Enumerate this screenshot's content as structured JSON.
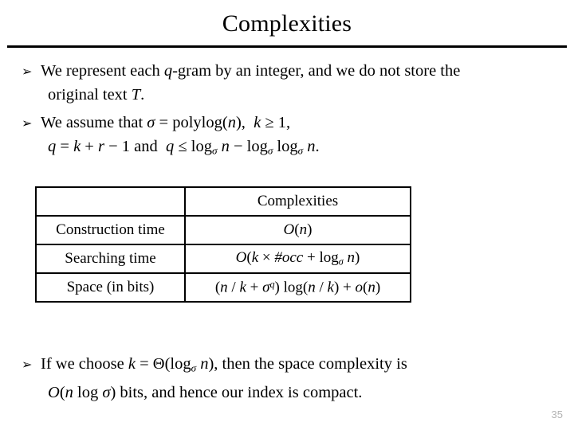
{
  "slide": {
    "title": "Complexities",
    "page_number": "35",
    "bullet_marker": "➢"
  },
  "bullets": [
    {
      "id": "bullet-1",
      "lines": [
        "We represent each q-gram by an integer, and we do not store the",
        "original text T."
      ],
      "text": "We represent each q-gram by an integer, and we do not store the original text T."
    },
    {
      "id": "bullet-2",
      "lines": [
        "We assume that σ = polylog(n),  k ≥ 1,",
        "q = k + r − 1 and  q ≤ logσ n − logσ logσ n."
      ],
      "text": "We assume that σ = polylog(n), k ≥ 1, q = k + r − 1 and q ≤ logσ n − logσ logσ n."
    },
    {
      "id": "bullet-3",
      "lines": [
        "If we choose k = Θ(logσ n), then the space complexity is",
        "O(n log σ) bits, and hence our index is compact."
      ],
      "text": "If we choose k = Θ(logσ n), then the space complexity is O(n log σ) bits, and hence our index is compact."
    }
  ],
  "table": {
    "headers": [
      "",
      "Complexities"
    ],
    "rows": [
      {
        "label": "Construction time",
        "value": "O(n)"
      },
      {
        "label": "Searching time",
        "value": "O(k × #occ + logσ n)"
      },
      {
        "label": "Space (in bits)",
        "value": "(n / k + σq) log(n / k) + o(n)"
      }
    ]
  },
  "colors": {
    "text": "#000000",
    "background": "#ffffff",
    "rule": "#000000",
    "page_number": "#b3b3b3"
  }
}
